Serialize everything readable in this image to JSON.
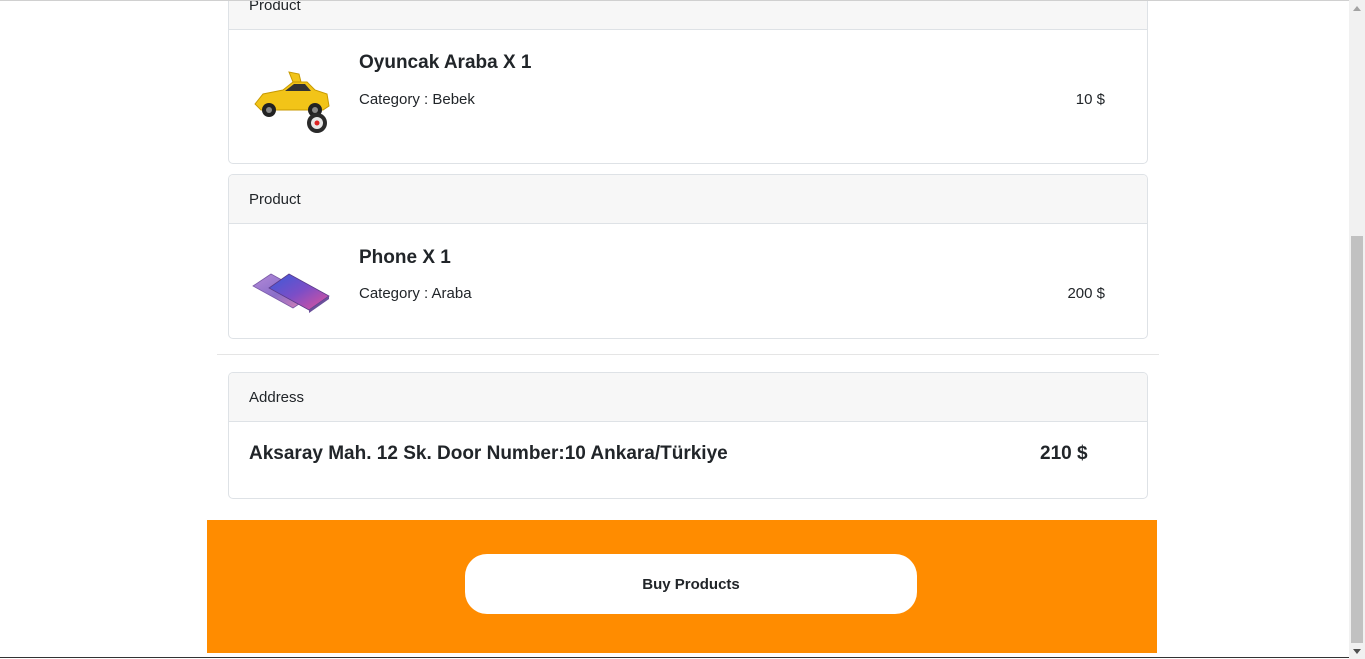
{
  "products": [
    {
      "header": "Product",
      "name": "Oyuncak Araba X 1",
      "category": "Category : Bebek",
      "price": "10 $",
      "icon": "toy-car-image"
    },
    {
      "header": "Product",
      "name": "Phone X 1",
      "category": "Category : Araba",
      "price": "200 $",
      "icon": "phone-image"
    }
  ],
  "address": {
    "header": "Address",
    "text": "Aksaray Mah. 12 Sk. Door Number:10 Ankara/Türkiye",
    "total": "210 $"
  },
  "buy_button": {
    "label": "Buy Products"
  },
  "colors": {
    "accent": "#ff8c00",
    "card_header_bg": "#f7f7f7",
    "border": "#dee2e6"
  }
}
